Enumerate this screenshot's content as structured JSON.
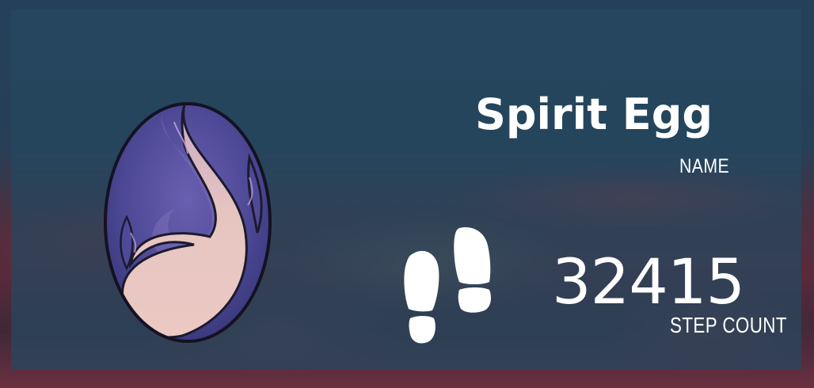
{
  "pet": {
    "name": "Spirit Egg",
    "name_label": "NAME",
    "icon": "spirit-egg-icon"
  },
  "steps": {
    "count": "32415",
    "label": "STEP COUNT",
    "icon": "footprints-icon"
  },
  "colors": {
    "panel": "#264860",
    "text": "#ffffff",
    "egg_shell": "#5a4f9a",
    "egg_flame": "#e8c7c2"
  }
}
